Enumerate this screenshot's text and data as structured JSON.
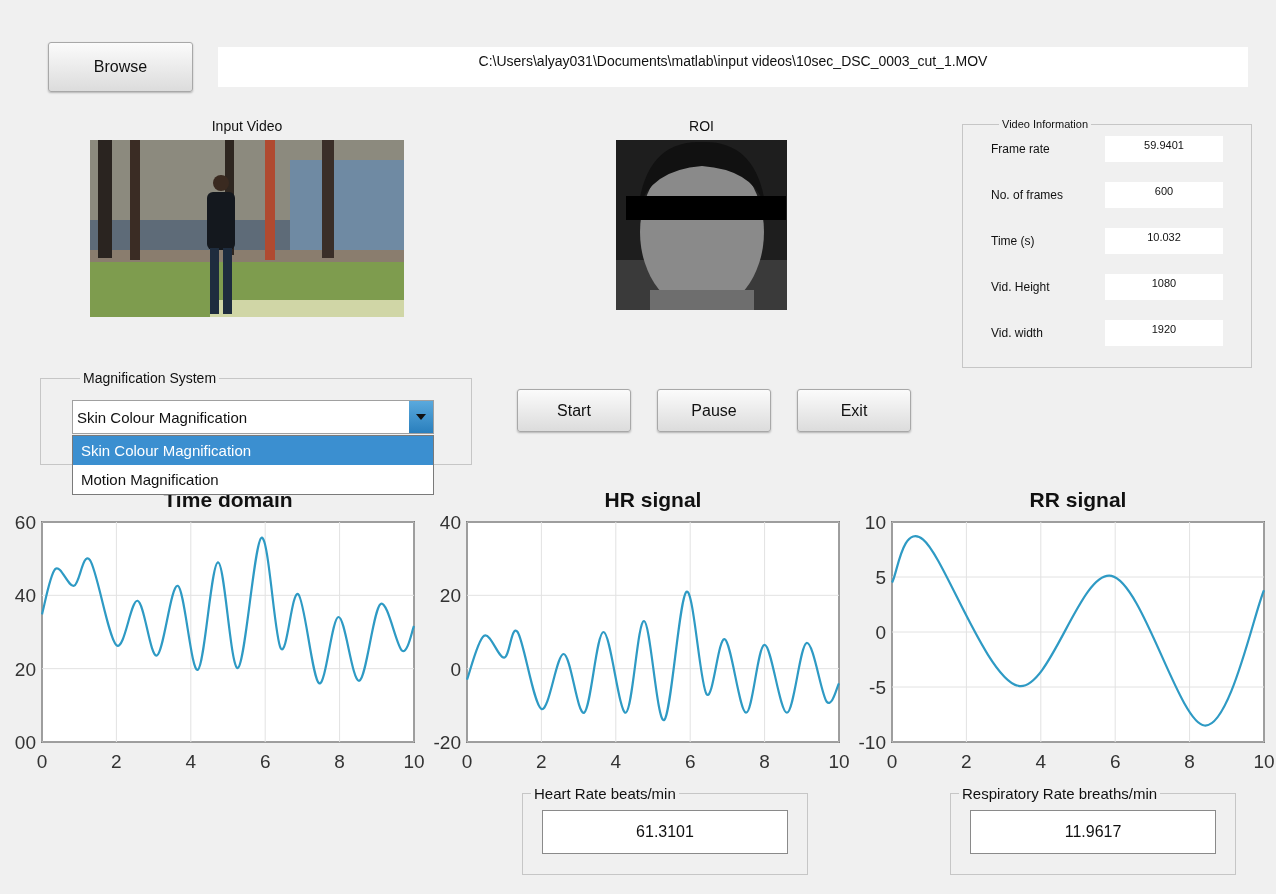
{
  "browse_button": "Browse",
  "file_path": "C:\\Users\\alyay031\\Documents\\matlab\\input videos\\10sec_DSC_0003_cut_1.MOV",
  "input_video": {
    "label": "Input Video",
    "kind": "picture"
  },
  "roi": {
    "label": "ROI",
    "kind": "picture"
  },
  "video_information": {
    "title": "Video Information",
    "fields": [
      {
        "label": "Frame rate",
        "value": "59.9401"
      },
      {
        "label": "No. of frames",
        "value": "600"
      },
      {
        "label": "Time (s)",
        "value": "10.032"
      },
      {
        "label": "Vid. Height",
        "value": "1080"
      },
      {
        "label": "Vid. width",
        "value": "1920"
      }
    ]
  },
  "magnification_system": {
    "title": "Magnification System",
    "value": "Skin Colour Magnification",
    "expanded": true,
    "options": [
      {
        "label": "Skin Colour Magnification",
        "selected": true
      },
      {
        "label": "Motion Magnification",
        "selected": false
      }
    ]
  },
  "buttons": [
    "Start",
    "Pause",
    "Exit"
  ],
  "charts": [
    {
      "chart_data": {
        "type": "line",
        "title": "Time domain",
        "xlim": [
          0,
          10
        ],
        "ylim": [
          0,
          60
        ],
        "xticks": [
          0,
          2,
          4,
          6,
          8,
          10
        ],
        "yticks": [
          {
            "value": 0,
            "label": "00"
          },
          20,
          40,
          60
        ],
        "x": [
          0,
          0.36,
          0.86,
          1.29,
          2.0,
          2.57,
          3.09,
          3.65,
          4.19,
          4.73,
          5.27,
          5.9,
          6.42,
          6.89,
          7.45,
          7.97,
          8.53,
          9.1,
          9.68,
          10
        ],
        "grid": true,
        "series": [
          {
            "color": "#2e9ac4",
            "values": [
              34.8,
              47.2,
              42.6,
              49.6,
              26.4,
              38.5,
              23.6,
              42.6,
              19.7,
              49.0,
              20.2,
              55.7,
              25.5,
              40.3,
              16.0,
              34.1,
              16.7,
              37.6,
              24.9,
              31.6
            ]
          }
        ]
      }
    },
    {
      "chart_data": {
        "type": "line",
        "title": "HR signal",
        "xlim": [
          0,
          10
        ],
        "ylim": [
          -20,
          40
        ],
        "xticks": [
          0,
          2,
          4,
          6,
          8,
          10
        ],
        "yticks": [
          -20,
          0,
          20,
          40
        ],
        "x": [
          0,
          0.46,
          1.0,
          1.36,
          2.0,
          2.6,
          3.15,
          3.67,
          4.27,
          4.76,
          5.3,
          5.9,
          6.44,
          6.93,
          7.5,
          8.0,
          8.6,
          9.13,
          9.67,
          10
        ],
        "grid": true,
        "series": [
          {
            "color": "#2e9ac4",
            "values": [
              -3,
              9,
              3,
              10,
              -11,
              4,
              -12,
              10,
              -12,
              13,
              -14,
              21,
              -7,
              8,
              -12,
              6.5,
              -12,
              7,
              -9,
              -4
            ]
          }
        ]
      },
      "output": {
        "title": "Heart Rate beats/min",
        "value": "61.3101"
      }
    },
    {
      "chart_data": {
        "type": "line",
        "title": "RR signal",
        "xlim": [
          0,
          10
        ],
        "ylim": [
          -10,
          10
        ],
        "xticks": [
          0,
          2,
          4,
          6,
          8,
          10
        ],
        "yticks": [
          -10,
          -5,
          0,
          5,
          10
        ],
        "x": [
          0,
          0.84,
          3.4,
          5.9,
          8.4,
          10
        ],
        "grid": true,
        "series": [
          {
            "color": "#2e9ac4",
            "values": [
              4.5,
              8.4,
              -4.9,
              5.1,
              -8.5,
              3.8
            ]
          }
        ]
      },
      "output": {
        "title": "Respiratory Rate breaths/min",
        "value": "11.9617"
      }
    }
  ]
}
